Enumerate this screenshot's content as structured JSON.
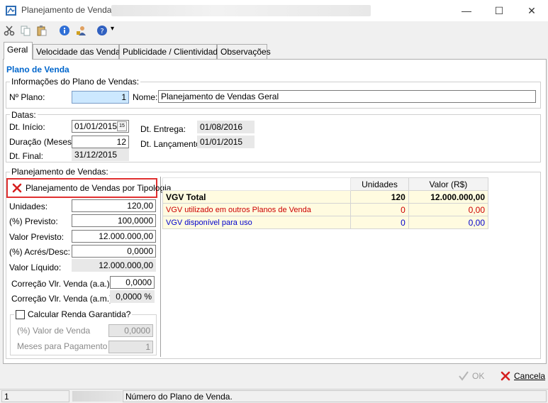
{
  "window": {
    "title": "Planejamento de Venda",
    "minimize": "—",
    "maximize": "☐",
    "close": "✕"
  },
  "toolbar": {
    "dropdown_caret": "▾"
  },
  "tabs": [
    {
      "label": "Geral"
    },
    {
      "label": "Velocidade das Vendas"
    },
    {
      "label": "Publicidade / Clientividade"
    },
    {
      "label": "Observações"
    }
  ],
  "section_title": "Plano de Venda",
  "plan_info": {
    "legend": "Informações do Plano de Vendas:",
    "number_label": "Nº Plano:",
    "number_value": "1",
    "name_label": "Nome:",
    "name_value": "Planejamento de Vendas Geral"
  },
  "dates": {
    "legend": "Datas:",
    "start_label": "Dt. Início:",
    "start_value": "01/01/2015",
    "calendar_glyph": "15",
    "duration_label": "Duração (Meses):",
    "duration_value": "12",
    "end_label": "Dt. Final:",
    "end_value": "31/12/2015",
    "delivery_label": "Dt. Entrega:",
    "delivery_value": "01/08/2016",
    "launch_label": "Dt. Lançamento:",
    "launch_value": "01/01/2015"
  },
  "planning": {
    "legend": "Planejamento de Vendas:",
    "typology_button": "Planejamento de Vendas por Tipologia",
    "units_label": "Unidades:",
    "units_value": "120,00",
    "percent_label": "(%) Previsto:",
    "percent_value": "100,0000",
    "forecast_label": "Valor Previsto:",
    "forecast_value": "12.000.000,00",
    "adj_label": "(%) Acrés/Desc:",
    "adj_value": "0,0000",
    "net_label": "Valor Líquido:",
    "net_value": "12.000.000,00",
    "corr_aa_label": "Correção Vlr. Venda (a.a.):",
    "corr_aa_value": "0,0000",
    "corr_am_label": "Correção Vlr. Venda (a.m.):",
    "corr_am_value": "0,0000 %",
    "income_checkbox": "Calcular Renda Garantida?",
    "sale_pct_label": "(%) Valor de Venda",
    "sale_pct_value": "0,0000",
    "months_label": "Meses para Pagamento",
    "months_value": "1"
  },
  "vgv_grid": {
    "headers": [
      "Unidades",
      "Valor (R$)"
    ],
    "rows": [
      {
        "label": "VGV Total",
        "units": "120",
        "value": "12.000.000,00"
      },
      {
        "label": "VGV utilizado em outros Planos de Venda",
        "units": "0",
        "value": "0,00"
      },
      {
        "label": "VGV disponível para uso",
        "units": "0",
        "value": "0,00"
      }
    ]
  },
  "buttons": {
    "ok": "OK",
    "cancel": "Cancela"
  },
  "status": {
    "left": "1",
    "message": "Número do Plano de Venda."
  },
  "colors": {
    "accent_blue": "#0066cc",
    "highlight_red": "#e03030",
    "row_red": "#cc0000",
    "row_blue": "#0000cc",
    "grid_yellow": "#fffbe0"
  }
}
